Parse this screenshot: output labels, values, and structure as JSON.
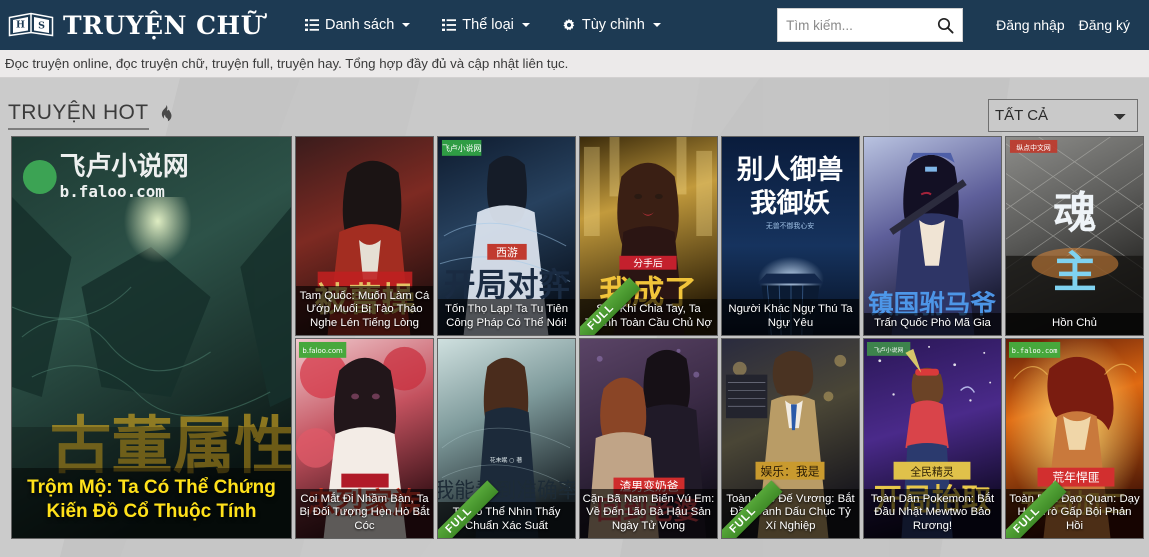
{
  "site": {
    "brand_name": "TRUYỆN CHỮ",
    "logo_letters": "HS",
    "tagline": "Đọc truyện online, đọc truyện chữ, truyện full, truyện hay. Tổng hợp đầy đủ và cập nhật liên tục."
  },
  "nav": {
    "items": [
      {
        "label": "Danh sách",
        "icon": "list-icon",
        "has_caret": true
      },
      {
        "label": "Thể loại",
        "icon": "list-icon",
        "has_caret": true
      },
      {
        "label": "Tùy chỉnh",
        "icon": "gear-icon",
        "has_caret": true
      }
    ],
    "login_label": "Đăng nhập",
    "register_label": "Đăng ký"
  },
  "search": {
    "placeholder": "Tìm kiếm...",
    "value": "",
    "icon": "search-icon"
  },
  "section": {
    "title": "TRUYỆN HOT",
    "icon": "fire-icon",
    "filter_selected": "TẤT CẢ"
  },
  "colors": {
    "header_bg": "#1d3a53",
    "tagline_bg": "#eceaea",
    "page_bg": "#c7c7c7",
    "featured_title": "#ffe11a",
    "ribbon_green": "#4f9c33"
  },
  "books": [
    {
      "title": "Trộm Mộ: Ta Có Thể Chứng Kiến Đồ Cổ Thuộc Tính",
      "featured": true,
      "full": false,
      "cover_alt": "dark-green-cavern-cover"
    },
    {
      "title": "Tam Quốc: Muốn Làm Cá Ướp Muối Bị Tào Tháo Nghe Lén Tiếng Lòng",
      "featured": false,
      "full": false,
      "cover_alt": "red-robed-warrior-cover"
    },
    {
      "title": "Tốn Thọ Lạp! Ta Tu Tiên Công Pháp Có Thể Nói!",
      "featured": false,
      "full": false,
      "cover_alt": "blue-immortal-cover"
    },
    {
      "title": "Sau Khi Chia Tay, Ta Thành Toàn Cầu Chủ Nợ",
      "featured": false,
      "full": true,
      "cover_alt": "golden-woman-cover"
    },
    {
      "title": "Người Khác Ngự Thú Ta Ngự Yêu",
      "featured": false,
      "full": false,
      "cover_alt": "blue-temple-night-cover"
    },
    {
      "title": "Trấn Quốc Phò Mã Gia",
      "featured": false,
      "full": false,
      "cover_alt": "purple-swordsman-cover"
    },
    {
      "title": "Hồn Chủ",
      "featured": false,
      "full": false,
      "cover_alt": "grey-fence-city-cover"
    },
    {
      "title": "Coi Mắt Đi Nhầm Bàn, Ta Bị Đối Tượng Hẹn Hò Bắt Cóc",
      "featured": false,
      "full": false,
      "cover_alt": "red-umbrella-girl-cover"
    },
    {
      "title": "Ta Có Thể Nhìn Thấy Chuẩn Xác Suất",
      "featured": false,
      "full": true,
      "cover_alt": "blue-dress-woman-cover"
    },
    {
      "title": "Cặn Bã Nam Biến Vú Em: Về Đến Lão Bà Hậu Sản Ngày Tử Vong",
      "featured": false,
      "full": false,
      "cover_alt": "couple-romance-cover"
    },
    {
      "title": "Toàn Hào Đế Vương: Bắt Đầu Đánh Dấu Chục Tỷ Xí Nghiệp",
      "featured": false,
      "full": true,
      "cover_alt": "suited-man-city-cover"
    },
    {
      "title": "Toàn Dân Pokemon: Bắt Đầu Nhật Mewtwo Bảo Rương!",
      "featured": false,
      "full": false,
      "cover_alt": "starry-night-trainer-cover"
    },
    {
      "title": "Toàn Dân Đạo Quan: Dạy Học Trò Gấp Bội Phản Hồi",
      "featured": false,
      "full": true,
      "cover_alt": "fire-warrior-cover"
    }
  ]
}
